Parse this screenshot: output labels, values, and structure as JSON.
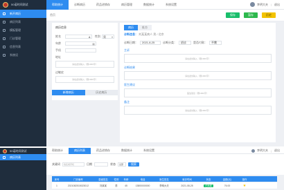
{
  "app": {
    "title": "50诺时间测试"
  },
  "top": {
    "sidebar": {
      "items": [
        {
          "label": "新开病历",
          "active": true
        },
        {
          "label": "病历列表"
        },
        {
          "label": "模板管理"
        },
        {
          "label": "门诊管理"
        },
        {
          "label": "信息列表"
        },
        {
          "label": "系统设"
        }
      ]
    },
    "tabs": [
      "帮助统计",
      "诊断病历",
      "药品进销存",
      "病历管理",
      "数据统计",
      "系统设置"
    ],
    "user": {
      "name": "李明大夫",
      "logout": "退出"
    },
    "breadcrumb": "首页",
    "buttons": {
      "save": "保存",
      "print": "暂存",
      "clear": "历史"
    },
    "form": {
      "title": "病历信息",
      "labels": {
        "name": "姓名",
        "sex": "性别",
        "age": "年龄",
        "phone": "手机",
        "addr": "地址",
        "history": "过敏史"
      },
      "sex_value": "男",
      "area_placeholder": "请在此处输入（限1000字）"
    },
    "left_tabs": {
      "active": "新增病历",
      "inactive": "历史病历"
    },
    "right": {
      "tabs": [
        "病历",
        "处方"
      ],
      "patient": {
        "label": "诊断信息：",
        "name": "刘某某病人",
        "extra": "男 / 北京"
      },
      "meta": {
        "date_label": "诊断日期：",
        "date_value": "2021-8-25",
        "type_label": "诊断分类：",
        "type_value": "初诊",
        "pay_label": "是否付款：",
        "pay_value": "不需"
      },
      "sections": [
        {
          "label": "主诉",
          "placeholder": "请在此处输入（限1000字）"
        },
        {
          "label": "诊断结果",
          "placeholder": "请在此处输入（限1000字）"
        },
        {
          "label": "医生建议",
          "placeholder": "医生建议（限1000字）"
        },
        {
          "label": "备注",
          "placeholder": "请在此处输入（限1000字）"
        }
      ]
    }
  },
  "bottom": {
    "sidebar": {
      "items": [
        {
          "label": "病历列表",
          "active": true
        }
      ]
    },
    "tabs": [
      "帮助统计",
      "病历列表",
      "药品进销存",
      "数据统计",
      "系统设置"
    ],
    "user": {
      "name": "李明大夫",
      "logout": "退出"
    },
    "search": {
      "label": "关键词",
      "placeholder": "姓名或手机",
      "date_label": "日期",
      "status_label": "状态",
      "status_value": "全部",
      "button": "搜索"
    },
    "table": {
      "headers": [
        "序号",
        "门诊编号",
        "患者姓名",
        "性别",
        "年龄",
        "电话",
        "医生姓名",
        "就诊时间",
        "状态",
        "金额(元)",
        "操作"
      ],
      "rows": [
        [
          "1",
          "2021082515023012",
          "刘某某",
          "男",
          "45",
          "13800000000",
          "李明大夫",
          "2021-08-25",
          "已完成",
          "76.00",
          "★"
        ]
      ]
    }
  }
}
